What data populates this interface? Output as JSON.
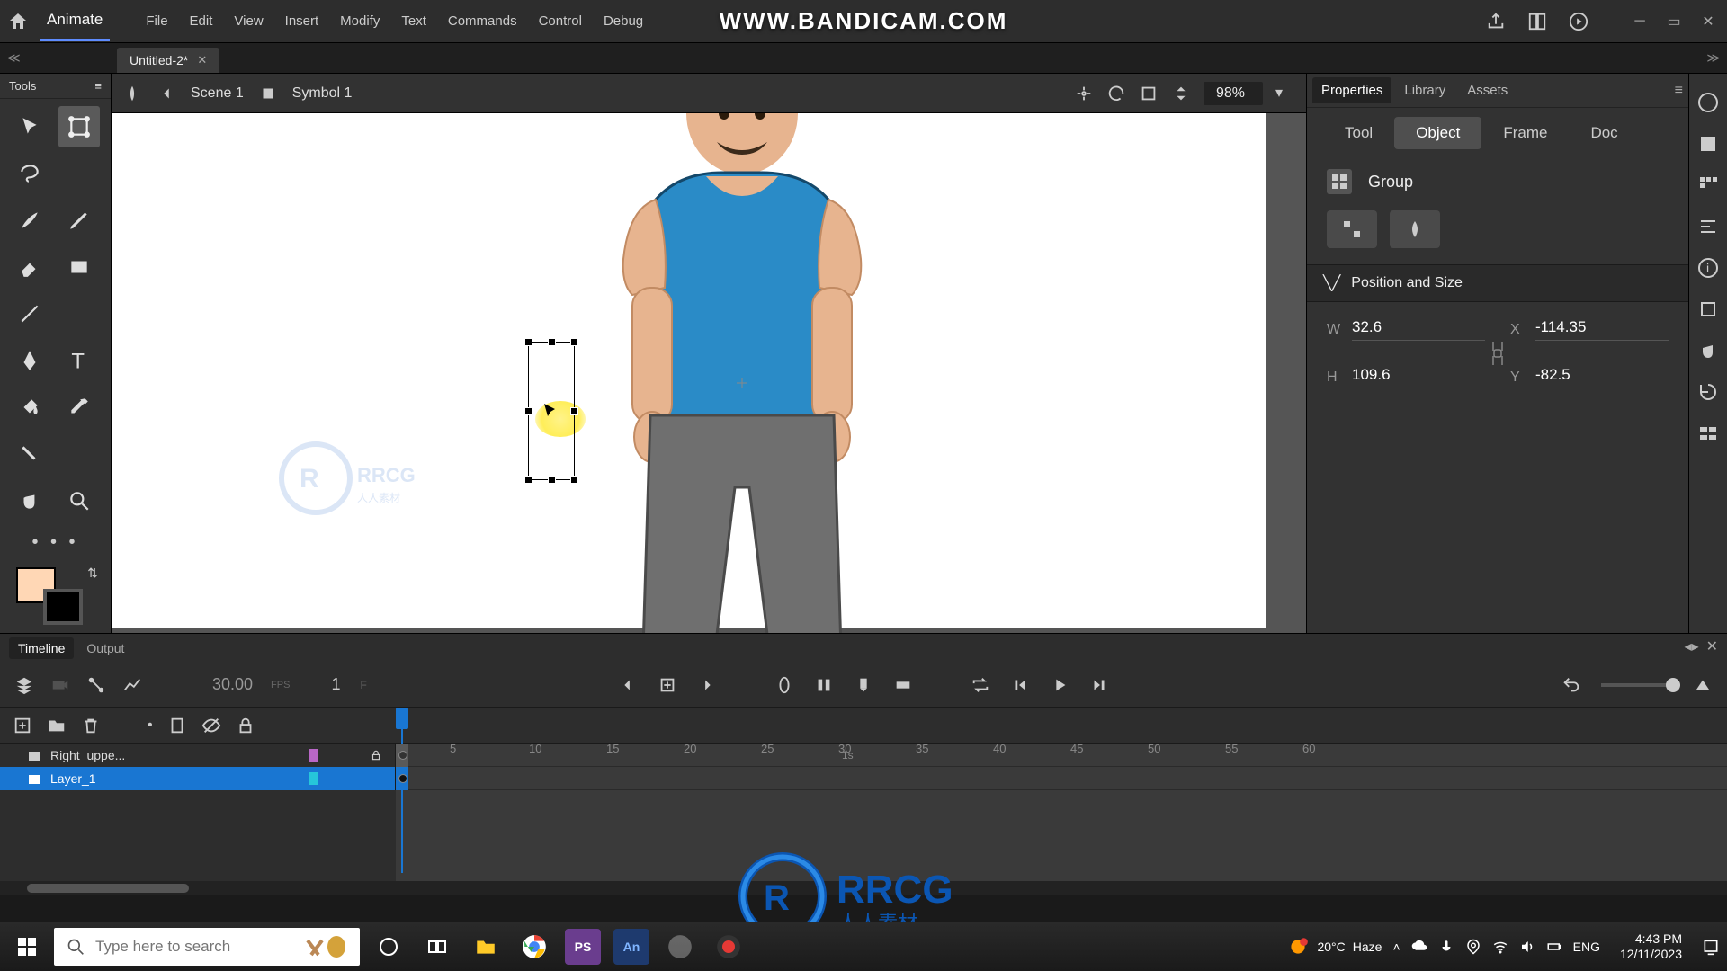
{
  "app": {
    "name": "Animate"
  },
  "menu": {
    "file": "File",
    "edit": "Edit",
    "view": "View",
    "insert": "Insert",
    "modify": "Modify",
    "text": "Text",
    "commands": "Commands",
    "control": "Control",
    "debug": "Debug"
  },
  "watermark": "WWW.BANDICAM.COM",
  "document": {
    "tab_title": "Untitled-2*"
  },
  "tools_panel": {
    "title": "Tools"
  },
  "scene_bar": {
    "scene": "Scene 1",
    "symbol": "Symbol 1",
    "zoom": "98%"
  },
  "swatches": {
    "fill": "#ffd7b5",
    "stroke": "#000000"
  },
  "properties": {
    "tabs": {
      "properties": "Properties",
      "library": "Library",
      "assets": "Assets"
    },
    "inner_tabs": {
      "tool": "Tool",
      "object": "Object",
      "frame": "Frame",
      "doc": "Doc"
    },
    "group_label": "Group",
    "section_position": "Position and Size",
    "w_label": "W",
    "w_value": "32.6",
    "h_label": "H",
    "h_value": "109.6",
    "x_label": "X",
    "x_value": "-114.35",
    "y_label": "Y",
    "y_value": "-82.5"
  },
  "timeline": {
    "tabs": {
      "timeline": "Timeline",
      "output": "Output"
    },
    "fps": "30.00",
    "fps_label": "FPS",
    "current_frame": "1",
    "current_frame_label": "F",
    "time_marker": "1s",
    "ruler_ticks": [
      "5",
      "10",
      "15",
      "20",
      "25",
      "30",
      "35",
      "40",
      "45",
      "50",
      "55",
      "60"
    ],
    "layers": [
      {
        "name": "Right_uppe...",
        "locked": true,
        "color": "#b967c7",
        "selected": false
      },
      {
        "name": "Layer_1",
        "locked": false,
        "color": "#26c6da",
        "selected": true
      }
    ]
  },
  "taskbar": {
    "search_placeholder": "Type here to search",
    "weather_temp": "20°C",
    "weather_desc": "Haze",
    "lang": "ENG",
    "time": "4:43 PM",
    "date": "12/11/2023"
  },
  "rrcg": "RRCG"
}
